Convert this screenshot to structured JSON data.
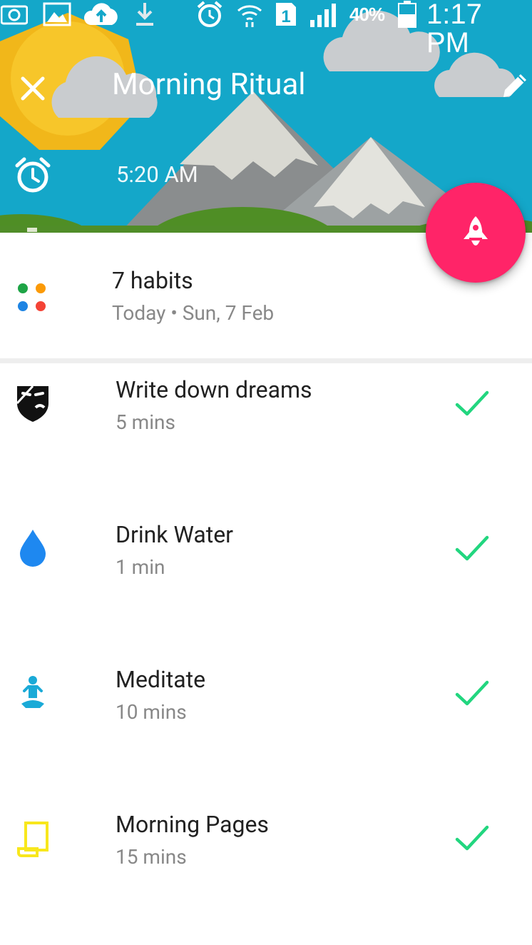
{
  "status_bar": {
    "battery_percent": "40%",
    "sim_slot": "1",
    "time": "1:17 PM"
  },
  "header": {
    "title": "Morning Ritual",
    "close_icon": "close-icon",
    "edit_icon": "pencil-icon",
    "alarm_icon": "alarm-clock-icon",
    "alarm_time": "5:20 AM"
  },
  "fab": {
    "icon": "rocket-icon",
    "color": "#ff2468"
  },
  "summary": {
    "count": "7 habits",
    "date": "Today • Sun, 7 Feb",
    "dot_colors": [
      "#1ea446",
      "#fb9a07",
      "#1e84e3",
      "#f44336"
    ]
  },
  "habits": [
    {
      "name": "Write down dreams",
      "duration": "5 mins",
      "icon": "theater-mask-icon",
      "color": "#111111",
      "done": true
    },
    {
      "name": "Drink Water",
      "duration": "1 min",
      "icon": "water-drop-icon",
      "color": "#1e88f0",
      "done": true
    },
    {
      "name": "Meditate",
      "duration": "10 mins",
      "icon": "meditation-icon",
      "color": "#1aaad7",
      "done": true
    },
    {
      "name": "Morning Pages",
      "duration": "15 mins",
      "icon": "scroll-icon",
      "color": "#f8e71c",
      "done": true
    }
  ],
  "colors": {
    "check": "#22d67f",
    "sky": "#14a7c9",
    "sun": "#f6c21a"
  }
}
